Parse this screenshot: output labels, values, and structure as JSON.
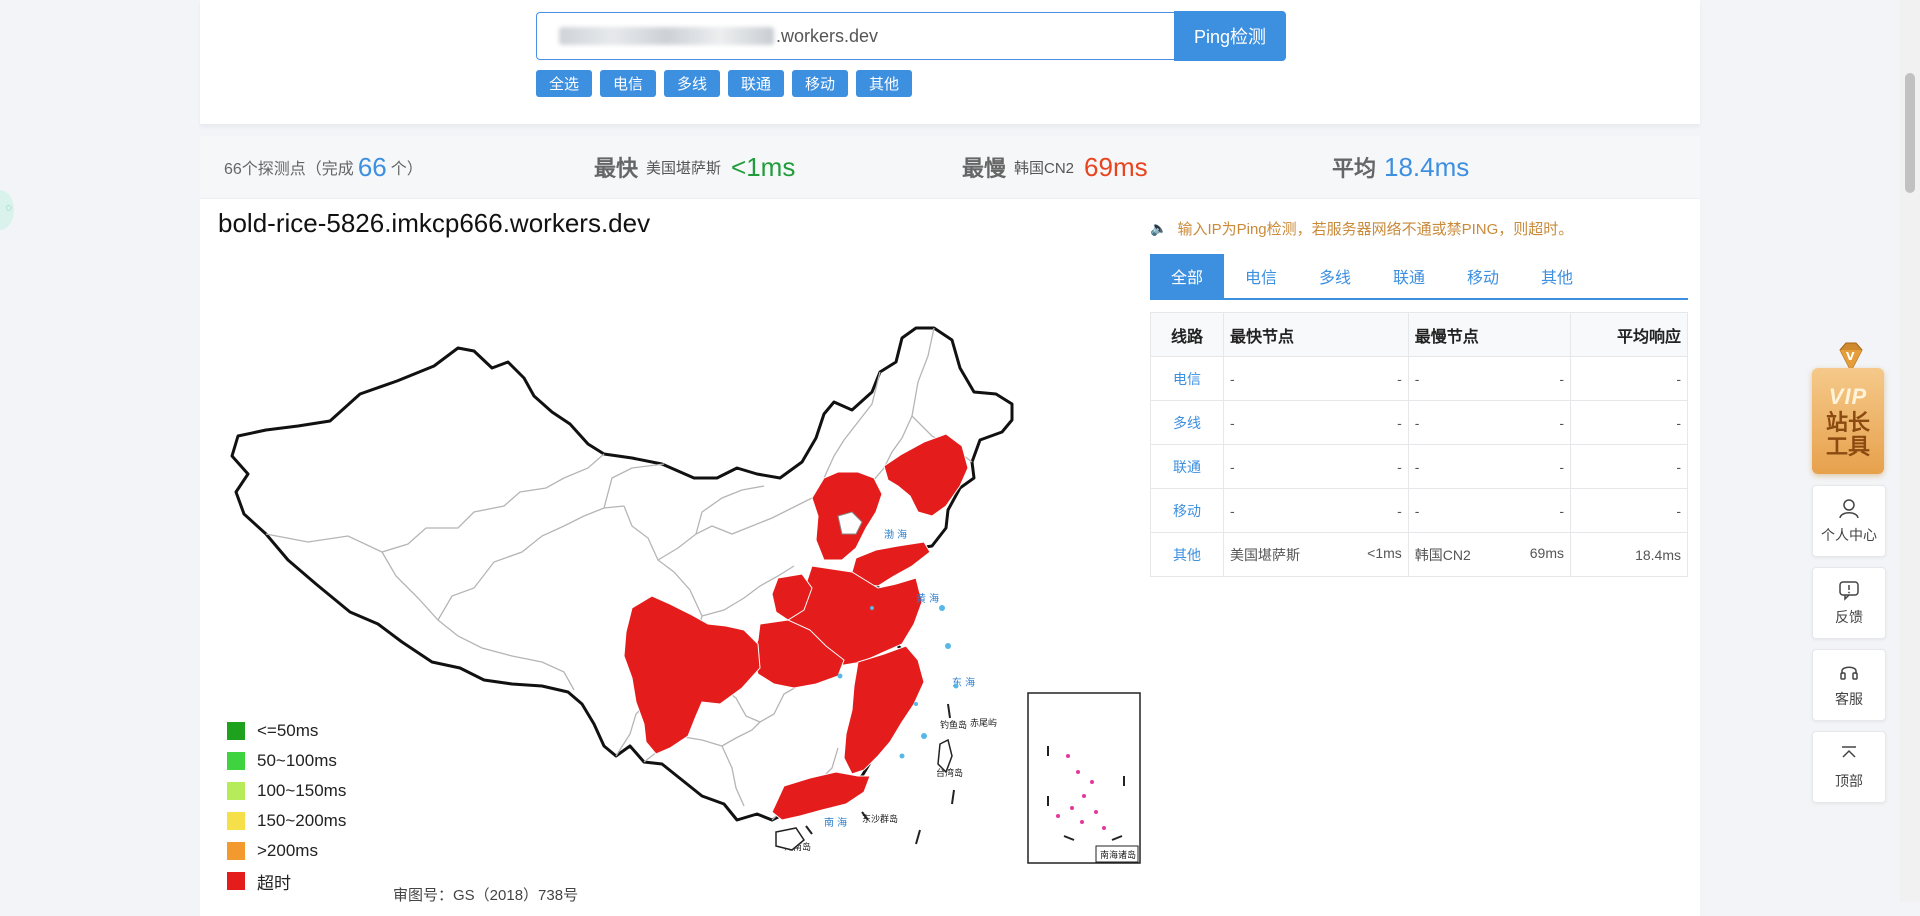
{
  "search": {
    "input_value_suffix": ".workers.dev",
    "button_label": "Ping检测",
    "filters": [
      "全选",
      "电信",
      "多线",
      "联通",
      "移动",
      "其他"
    ]
  },
  "stats": {
    "probe_count_prefix": "66个探测点（完成",
    "completed": "66",
    "probe_count_suffix": "个）",
    "fastest": {
      "title": "最快",
      "location": "美国堪萨斯",
      "value": "<1ms"
    },
    "slowest": {
      "title": "最慢",
      "location": "韩国CN2",
      "value": "69ms"
    },
    "average": {
      "title": "平均",
      "value": "18.4ms"
    }
  },
  "map": {
    "host": "bold-rice-5826.imkcp666.workers.dev",
    "approval": "审图号：GS（2018）738号",
    "labels": {
      "bohai": "渤 海",
      "huanghai": "黄 海",
      "donghai": "东 海",
      "nanhai": "南 海",
      "taiwan": "台湾岛",
      "hainan": "海南岛",
      "diaoyu": "钓鱼岛",
      "chiwei": "赤尾屿",
      "dongsha": "东沙群岛",
      "inset_title": "南海诸岛"
    },
    "legend": [
      {
        "label": "<=50ms",
        "color": "#1ea21e"
      },
      {
        "label": "50~100ms",
        "color": "#3fd33f"
      },
      {
        "label": "100~150ms",
        "color": "#b6ec5a"
      },
      {
        "label": "150~200ms",
        "color": "#f5e04a"
      },
      {
        "label": ">200ms",
        "color": "#f39a2f"
      },
      {
        "label": "超时",
        "color": "#e51c1c"
      }
    ]
  },
  "notice": "输入IP为Ping检测，若服务器网络不通或禁PING，则超时。",
  "tabs": [
    "全部",
    "电信",
    "多线",
    "联通",
    "移动",
    "其他"
  ],
  "table": {
    "headers": {
      "line": "线路",
      "fast": "最快节点",
      "slow": "最慢节点",
      "avg": "平均响应"
    },
    "rows": [
      {
        "line": "电信",
        "fast_node": "-",
        "fast_val": "-",
        "slow_node": "-",
        "slow_val": "-",
        "avg": "-"
      },
      {
        "line": "多线",
        "fast_node": "-",
        "fast_val": "-",
        "slow_node": "-",
        "slow_val": "-",
        "avg": "-"
      },
      {
        "line": "联通",
        "fast_node": "-",
        "fast_val": "-",
        "slow_node": "-",
        "slow_val": "-",
        "avg": "-"
      },
      {
        "line": "移动",
        "fast_node": "-",
        "fast_val": "-",
        "slow_node": "-",
        "slow_val": "-",
        "avg": "-"
      },
      {
        "line": "其他",
        "fast_node": "美国堪萨斯",
        "fast_val": "<1ms",
        "slow_node": "韩国CN2",
        "slow_val": "69ms",
        "avg": "18.4ms"
      }
    ]
  },
  "side": {
    "vip_text": "VIP",
    "vip_sub_1": "站长",
    "vip_sub_2": "工具",
    "gem_letter": "V",
    "buttons": [
      "个人中心",
      "反馈",
      "客服",
      "顶部"
    ]
  },
  "colors": {
    "accent": "#3d8fe0",
    "timeout": "#e51c1c"
  }
}
